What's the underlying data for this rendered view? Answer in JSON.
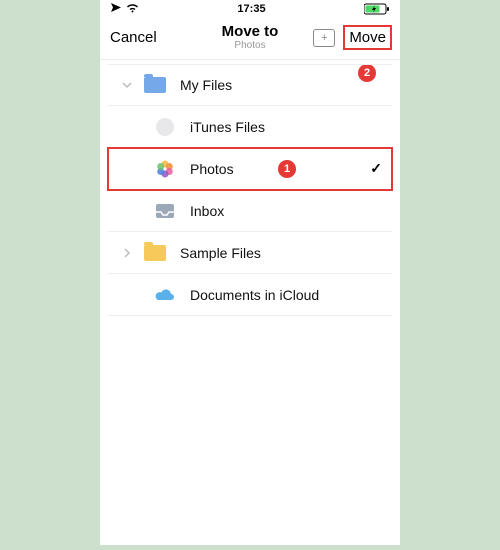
{
  "statusbar": {
    "time": "17:35"
  },
  "nav": {
    "cancel": "Cancel",
    "title": "Move to",
    "subtitle": "Photos",
    "move": "Move"
  },
  "list": {
    "myFiles": "My Files",
    "itunes": "iTunes Files",
    "photos": "Photos",
    "inbox": "Inbox",
    "sample": "Sample Files",
    "icloud": "Documents in iCloud"
  },
  "markers": {
    "one": "1",
    "two": "2"
  }
}
